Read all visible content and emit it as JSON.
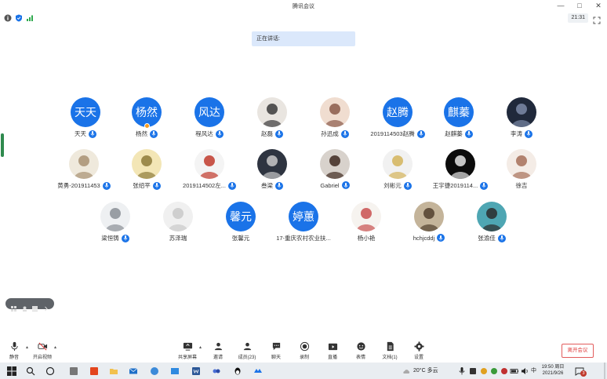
{
  "window": {
    "title": "腾讯会议",
    "controls": [
      "—",
      "□",
      "✕"
    ]
  },
  "status": {
    "timer": "21:31"
  },
  "speaking": {
    "label": "正在讲话:"
  },
  "participants": [
    {
      "name": "天天",
      "avatar_text": "天天",
      "avatar_kind": "text",
      "mic": true
    },
    {
      "name": "杨然",
      "avatar_text": "杨然",
      "avatar_kind": "text",
      "mic": true,
      "badge": true
    },
    {
      "name": "程风达",
      "avatar_text": "风达",
      "avatar_kind": "text",
      "mic": true
    },
    {
      "name": "赵磊",
      "avatar_kind": "photo",
      "mic": true
    },
    {
      "name": "孙迅成",
      "avatar_kind": "photo",
      "mic": true
    },
    {
      "name": "2019114503赵腾",
      "avatar_text": "赵腾",
      "avatar_kind": "text",
      "mic": true
    },
    {
      "name": "赵麒蓁",
      "avatar_text": "麒蓁",
      "avatar_kind": "text",
      "mic": true
    },
    {
      "name": "李涛",
      "avatar_kind": "photo",
      "mic": true
    },
    {
      "name": "黄勇-201911453",
      "avatar_kind": "photo",
      "mic": true
    },
    {
      "name": "张绍平",
      "avatar_kind": "photo",
      "mic": true
    },
    {
      "name": "2019114502左...",
      "avatar_kind": "photo",
      "mic": true
    },
    {
      "name": "叁梁",
      "avatar_kind": "photo",
      "mic": true
    },
    {
      "name": "Gabriel",
      "avatar_kind": "photo",
      "mic": true
    },
    {
      "name": "刘彬元",
      "avatar_kind": "photo",
      "mic": true
    },
    {
      "name": "王宇捷2019114...",
      "avatar_kind": "photo",
      "mic": true
    },
    {
      "name": "徐吉",
      "avatar_kind": "photo",
      "mic": false
    },
    {
      "name": "梁恒铸",
      "avatar_kind": "photo",
      "mic": true
    },
    {
      "name": "苏泽瑞",
      "avatar_kind": "photo",
      "mic": false
    },
    {
      "name": "张馨元",
      "avatar_text": "馨元",
      "avatar_kind": "text",
      "mic": false
    },
    {
      "name": "17-重庆农村农业扶...",
      "avatar_text": "婷蕙",
      "avatar_kind": "text",
      "mic": false
    },
    {
      "name": "杨小艳",
      "avatar_kind": "photo",
      "mic": false
    },
    {
      "name": "hchjcddj",
      "avatar_kind": "photo",
      "mic": true
    },
    {
      "name": "张渝佳",
      "avatar_kind": "photo",
      "mic": true
    }
  ],
  "toolbar": {
    "mute": "静音",
    "video": "开启视频",
    "share": "共享屏幕",
    "invite": "邀请",
    "members": "成员(23)",
    "chat": "聊天",
    "record": "录制",
    "live": "直播",
    "reactions": "表情",
    "docs": "文档(1)",
    "settings": "设置",
    "leave": "离开会议"
  },
  "taskbar": {
    "weather": "20°C 多云",
    "ime": "中",
    "time": "19:50 周日",
    "date": "2021/9/26",
    "notifications": "3"
  },
  "colors": {
    "accent": "#1a73e8",
    "leave": "#e04040",
    "speaking_bg": "#dbe8fb",
    "taskbar": "#e9edf1"
  }
}
